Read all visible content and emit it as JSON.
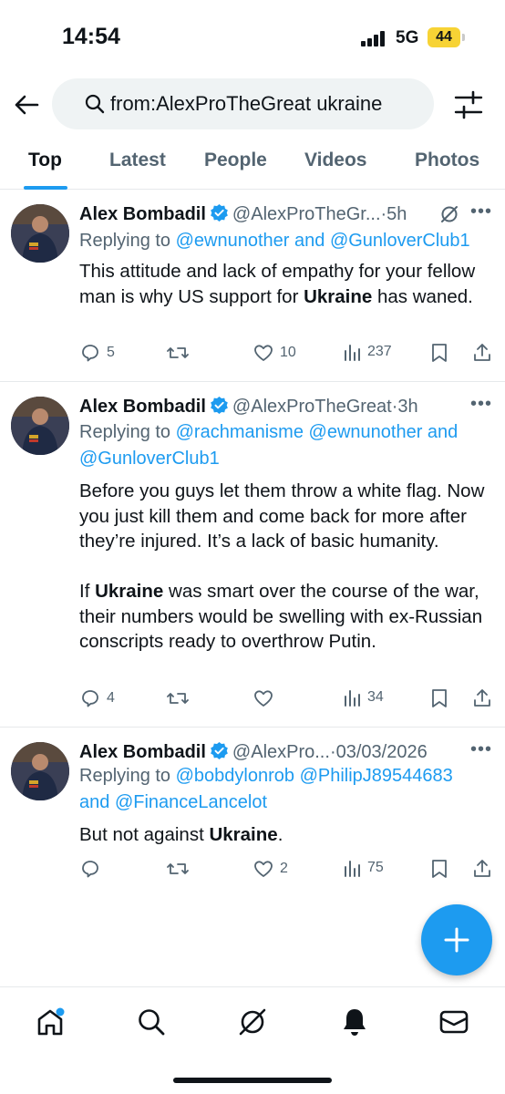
{
  "status_bar": {
    "time": "14:54",
    "network": "5G",
    "battery": "44"
  },
  "search": {
    "query": "from:AlexProTheGreat ukraine"
  },
  "tabs": [
    {
      "label": "Top"
    },
    {
      "label": "Latest"
    },
    {
      "label": "People"
    },
    {
      "label": "Videos"
    },
    {
      "label": "Photos"
    }
  ],
  "tweets": [
    {
      "name": "Alex Bombadil",
      "handle": "@AlexProTheGr...",
      "time": "·5h",
      "reply_prefix": "Replying to ",
      "reply_users": [
        "@ewnunother",
        "@GunloverClub1"
      ],
      "reply_and": " and ",
      "text_parts": [
        "This attitude and lack of empathy for your fellow man is why US support for ",
        "Ukraine",
        " has waned."
      ],
      "replies": "5",
      "retweets": "",
      "likes": "10",
      "views": "237"
    },
    {
      "name": "Alex Bombadil",
      "handle": "@AlexProTheGreat",
      "time": "·3h",
      "reply_prefix": "Replying to ",
      "reply_users": [
        "@rachmanisme",
        "@ewnunother",
        "@GunloverClub1"
      ],
      "reply_and": " and ",
      "text_p1": "Before you guys let them throw a white flag. Now you just kill them and come back for more after they’re injured. It’s a lack of basic humanity.",
      "text_parts": [
        "If ",
        "Ukraine",
        " was smart over the course of the war, their numbers would be swelling with ex-Russian conscripts ready to overthrow Putin."
      ],
      "replies": "4",
      "retweets": "",
      "likes": "",
      "views": "34"
    },
    {
      "name": "Alex Bombadil",
      "handle": "@AlexPro...",
      "time": "·03/03/2026",
      "reply_prefix": "Replying to ",
      "reply_users": [
        "@bobdylonrob",
        "@PhilipJ89544683",
        "@FinanceLancelot"
      ],
      "reply_and": "and ",
      "text_parts": [
        "But not against ",
        "Ukraine",
        "."
      ],
      "replies": "",
      "retweets": "",
      "likes": "2",
      "views": "75"
    }
  ],
  "colors": {
    "accent": "#1d9bf0",
    "muted": "#536471",
    "text": "#0f1419",
    "battery": "#f7d335"
  }
}
